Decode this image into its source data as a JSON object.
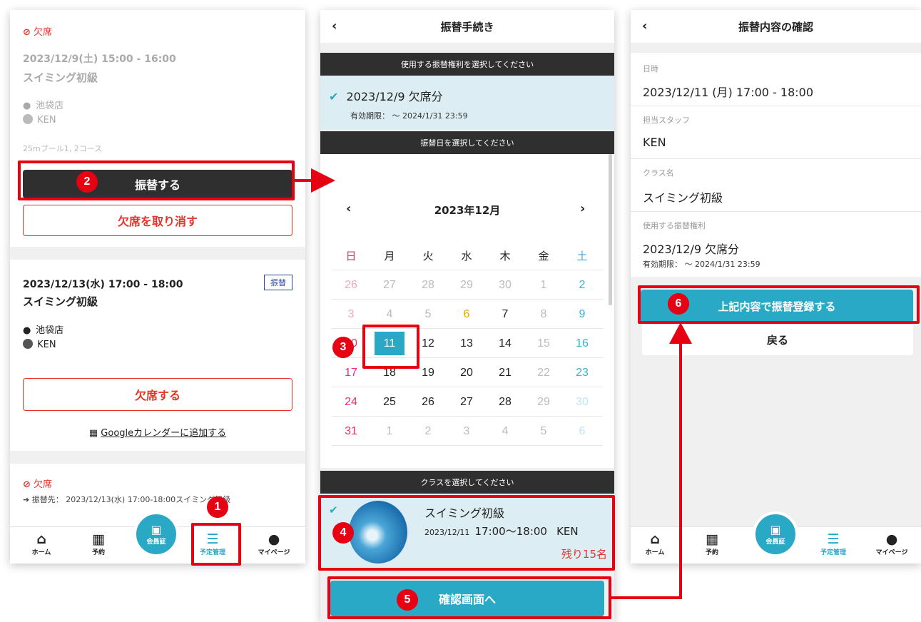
{
  "screen1": {
    "card1": {
      "status": "欠席",
      "datetime": "2023/12/9(土) 15:00 - 16:00",
      "class_name": "スイミング初級",
      "location": "池袋店",
      "staff": "KEN",
      "lane": "25mプール1, 2コース",
      "transfer_button": "振替する",
      "cancel_absence_button": "欠席を取り消す"
    },
    "card2": {
      "datetime": "2023/12/13(水) 17:00 - 18:00",
      "tag": "振替",
      "class_name": "スイミング初級",
      "location": "池袋店",
      "staff": "KEN",
      "absent_button": "欠席する",
      "google_calendar_link": "Googleカレンダーに追加する"
    },
    "card3": {
      "status": "欠席",
      "transfer_info": "振替先： 2023/12/13(水) 17:00-18:00スイミング初級"
    }
  },
  "screen2": {
    "title": "振替手続き",
    "section_right": "使用する振替権利を選択してください",
    "selected_right": "2023/12/9 欠席分",
    "expiry": "有効期限： ～ 2024/1/31 23:59",
    "section_date": "振替日を選択してください",
    "calendar": {
      "month": "2023年12月",
      "weekdays": [
        "日",
        "月",
        "火",
        "水",
        "木",
        "金",
        "土"
      ],
      "weeks": [
        [
          "26",
          "27",
          "28",
          "29",
          "30",
          "1",
          "2"
        ],
        [
          "3",
          "4",
          "5",
          "6",
          "7",
          "8",
          "9"
        ],
        [
          "10",
          "11",
          "12",
          "13",
          "14",
          "15",
          "16"
        ],
        [
          "17",
          "18",
          "19",
          "20",
          "21",
          "22",
          "23"
        ],
        [
          "24",
          "25",
          "26",
          "27",
          "28",
          "29",
          "30"
        ],
        [
          "31",
          "1",
          "2",
          "3",
          "4",
          "5",
          "6"
        ]
      ],
      "selected_day": "11"
    },
    "section_class": "クラスを選択してください",
    "class_card": {
      "name": "スイミング初級",
      "date": "2023/12/11",
      "time": "17:00～18:00",
      "staff": "KEN",
      "remaining": "残り15名"
    },
    "confirm_button": "確認画面へ"
  },
  "screen3": {
    "title": "振替内容の確認",
    "date_label": "日時",
    "date_value": "2023/12/11 (月) 17:00 - 18:00",
    "staff_label": "担当スタッフ",
    "staff_value": "KEN",
    "class_label": "クラス名",
    "class_value": "スイミング初級",
    "right_label": "使用する振替権利",
    "right_value": "2023/12/9 欠席分",
    "right_expiry": "有効期限： ～ 2024/1/31 23:59",
    "register_button": "上記内容で振替登録する",
    "back_button": "戻る"
  },
  "nav": {
    "home": "ホーム",
    "reserve": "予約",
    "member_card": "会員証",
    "schedule": "予定管理",
    "mypage": "マイページ"
  },
  "steps": [
    "1",
    "2",
    "3",
    "4",
    "5",
    "6"
  ],
  "colors": {
    "accent": "#2aa9c6",
    "alert_red": "#e5332a",
    "highlight_red": "#e60012",
    "dark_bar": "#2f2f2f",
    "light_blue_bg": "#dceef3",
    "sunday": "#e5336a",
    "saturday": "#3ab0d8",
    "today": "#e0a800"
  }
}
